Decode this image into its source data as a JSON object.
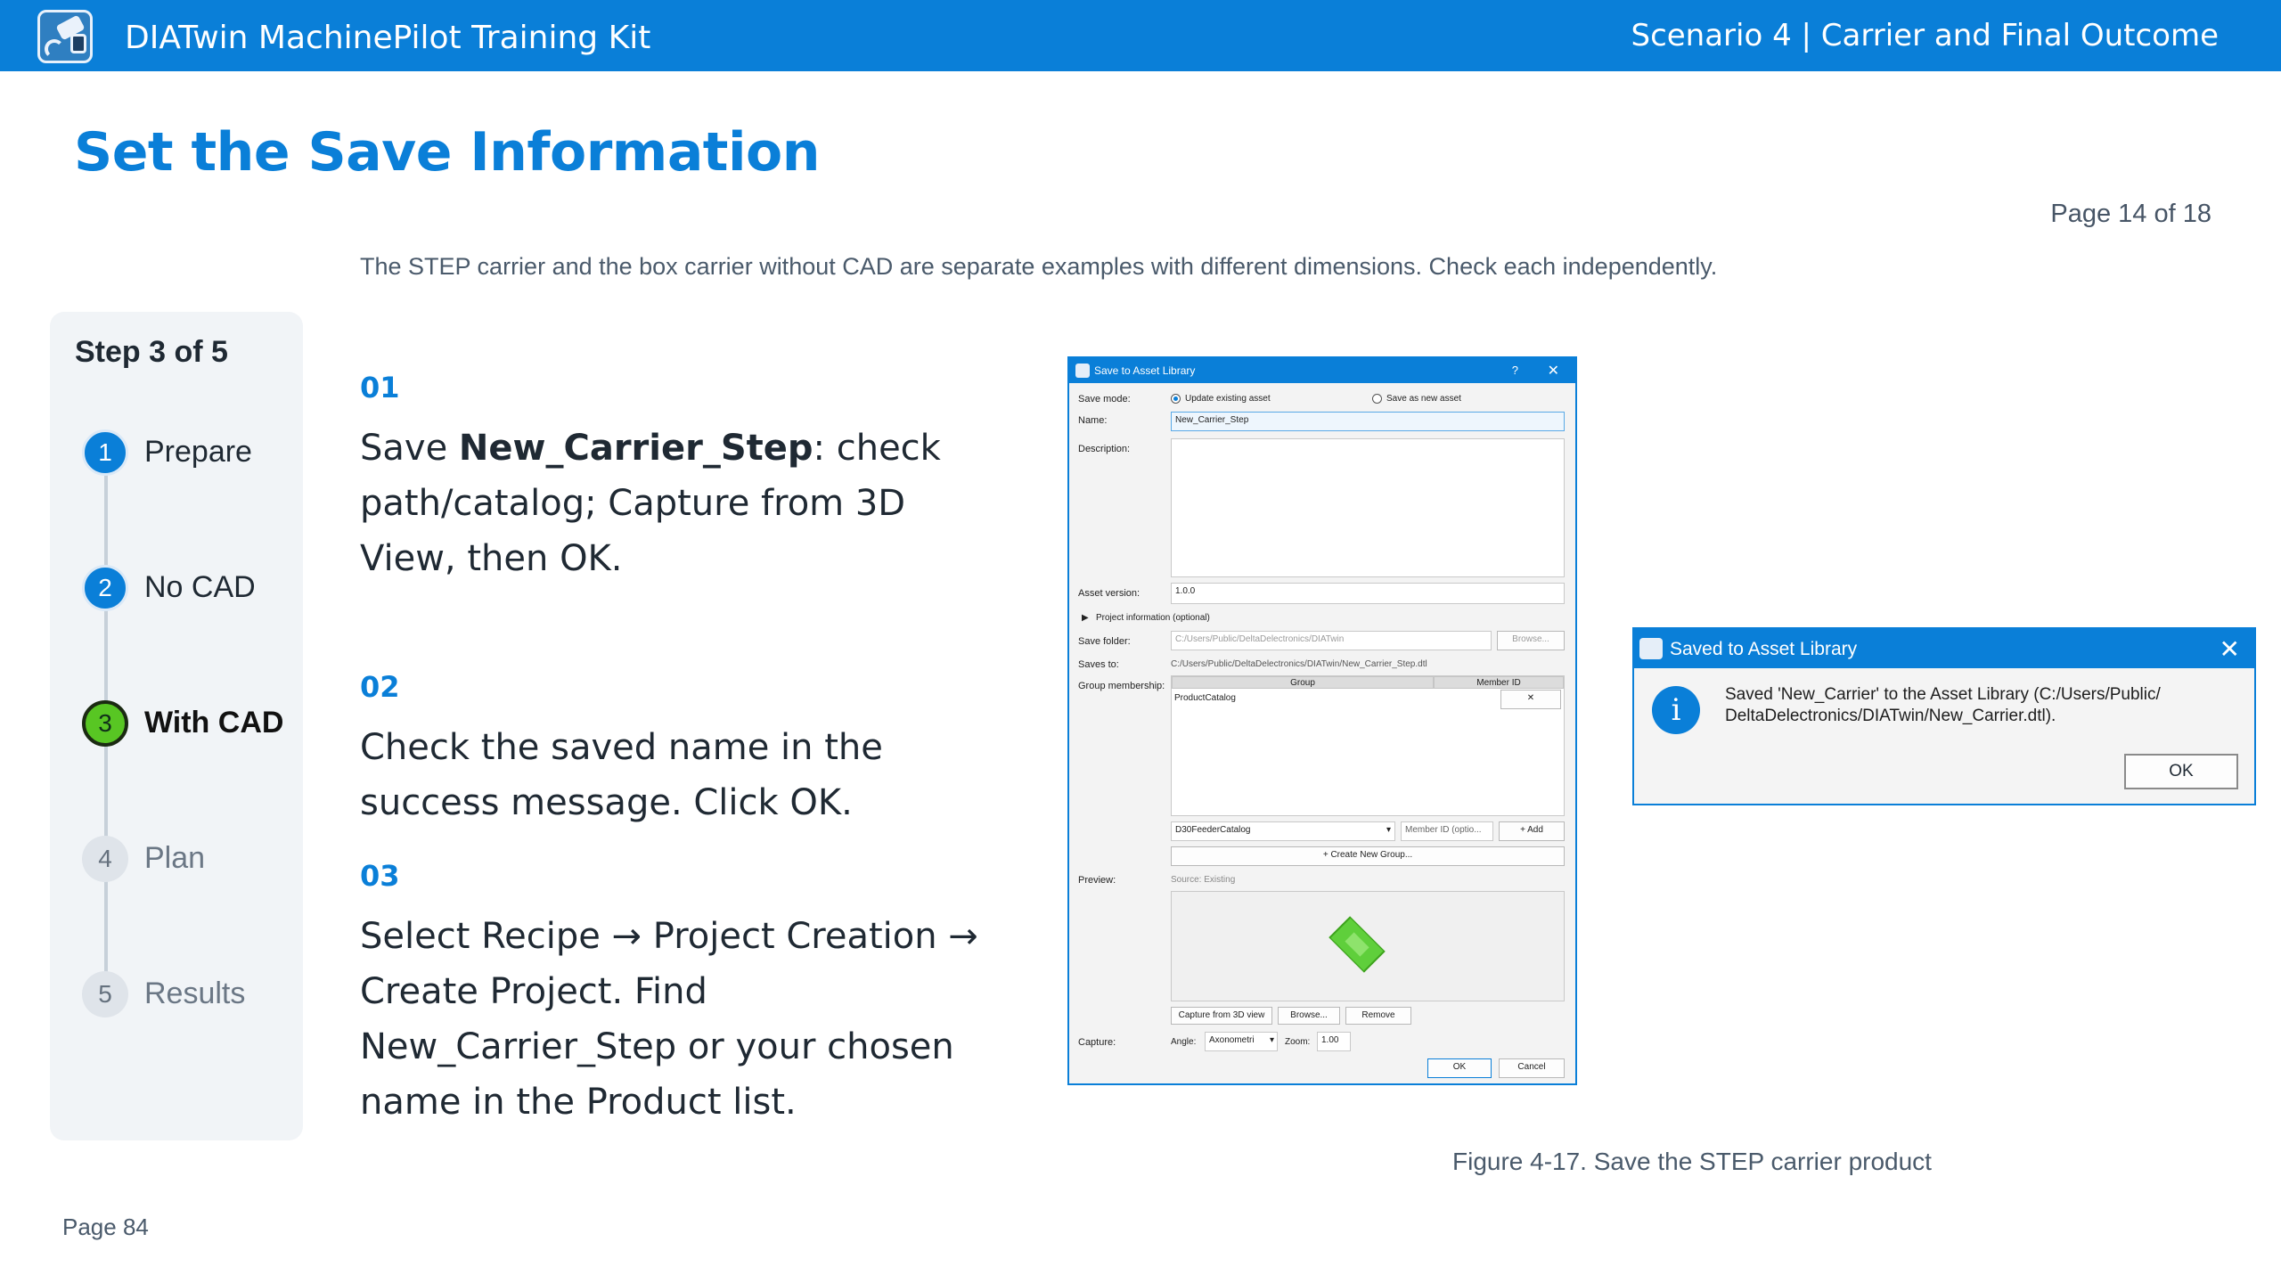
{
  "header": {
    "app_title": "DIATwin MachinePilot Training Kit",
    "scenario": "Scenario 4 | Carrier and Final Outcome",
    "logo_icon": "machinepilot-logo-icon",
    "color": "#0a7fd8"
  },
  "page": {
    "heading": "Set the Save Information",
    "counter": "Page 14 of 18",
    "intro": "The STEP carrier and the box carrier without CAD are separate examples with different dimensions. Check each independently.",
    "footer": "Page 84"
  },
  "stepper": {
    "title": "Step 3 of 5",
    "steps": [
      {
        "num": "1",
        "label": "Prepare",
        "state": "done"
      },
      {
        "num": "2",
        "label": "No CAD",
        "state": "done"
      },
      {
        "num": "3",
        "label": "With CAD",
        "state": "current"
      },
      {
        "num": "4",
        "label": "Plan",
        "state": "todo"
      },
      {
        "num": "5",
        "label": "Results",
        "state": "todo"
      }
    ],
    "colors": {
      "done": "#0a7fd8",
      "current": "#58c623",
      "todo": "#dfe4ea"
    }
  },
  "instructions": [
    {
      "num": "01",
      "pre": "Save ",
      "bold": "New_Carrier_Step",
      "post": ": check path/catalog; Capture from 3D View, then OK."
    },
    {
      "num": "02",
      "text": "Check the saved name in the success message. Click OK."
    },
    {
      "num": "03",
      "text": "Select Recipe → Project Creation → Create Project. Find New_Carrier_Step or your chosen name in the Product list."
    }
  ],
  "save_dialog": {
    "title": "Save to Asset Library",
    "help": "?",
    "close": "✕",
    "save_mode_label": "Save mode:",
    "mode_update": "Update existing asset",
    "mode_new": "Save as new asset",
    "name_label": "Name:",
    "name_value": "New_Carrier_Step",
    "description_label": "Description:",
    "version_label": "Asset version:",
    "version_value": "1.0.0",
    "project_info": "Project information (optional)",
    "save_folder_label": "Save folder:",
    "save_folder_value": "C:/Users/Public/DeltaDelectronics/DIATwin",
    "browse": "Browse...",
    "saves_to_label": "Saves to:",
    "saves_to_value": "C:/Users/Public/DeltaDelectronics/DIATwin/New_Carrier_Step.dtl",
    "group_label": "Group membership:",
    "col_group": "Group",
    "col_member": "Member ID",
    "group_row": "ProductCatalog",
    "remove_x": "✕",
    "catalog_select": "D30FeederCatalog",
    "member_placeholder": "Member ID (optio...",
    "add": "+ Add",
    "create_group": "+ Create New Group...",
    "preview_label": "Preview:",
    "source": "Source: Existing",
    "capture_3d": "Capture from 3D view",
    "browse2": "Browse...",
    "remove": "Remove",
    "capture_label": "Capture:",
    "angle_label": "Angle:",
    "angle_value": "Axonometri",
    "zoom_label": "Zoom:",
    "zoom_value": "1.00",
    "ok": "OK",
    "cancel": "Cancel"
  },
  "saved_dialog": {
    "title": "Saved to Asset Library",
    "close": "✕",
    "info_glyph": "i",
    "message": "Saved 'New_Carrier' to the Asset Library (C:/Users/Public/ DeltaDelectronics/DIATwin/New_Carrier.dtl).",
    "ok": "OK"
  },
  "figure_caption": "Figure 4-17. Save the STEP carrier product"
}
